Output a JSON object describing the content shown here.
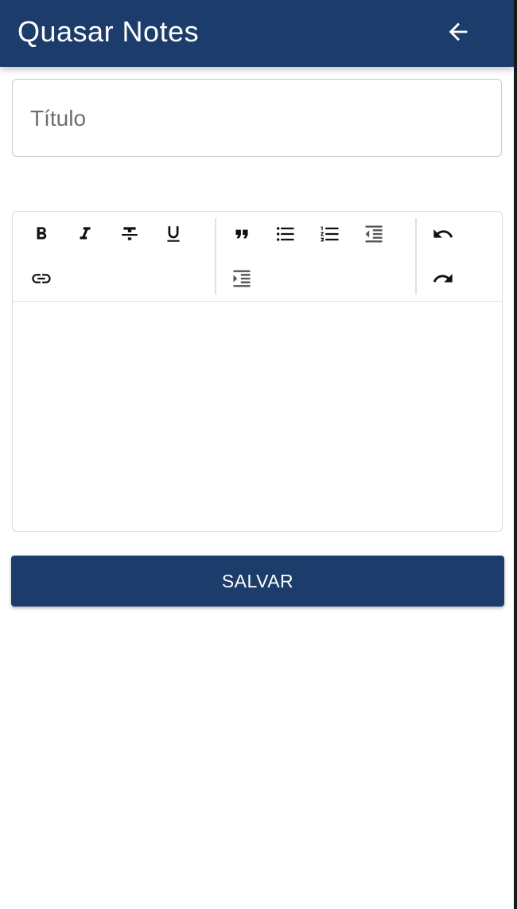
{
  "header": {
    "title": "Quasar Notes",
    "back_icon": "arrow-left-icon",
    "background_color": "#1c3d6b"
  },
  "form": {
    "title_placeholder": "Título",
    "title_value": "",
    "editor_content": "",
    "save_label": "SALVAR"
  },
  "toolbar": {
    "groups": [
      [
        "bold-icon",
        "italic-icon",
        "strikethrough-icon",
        "underline-icon",
        "link-icon"
      ],
      [
        "quote-icon",
        "bullet-list-icon",
        "numbered-list-icon",
        "outdent-icon",
        "indent-icon"
      ],
      [
        "undo-icon",
        "redo-icon"
      ]
    ]
  },
  "colors": {
    "primary": "#1c3d6b",
    "text": "#333333",
    "placeholder": "#6e6e6e",
    "border": "#c9c9c9"
  }
}
